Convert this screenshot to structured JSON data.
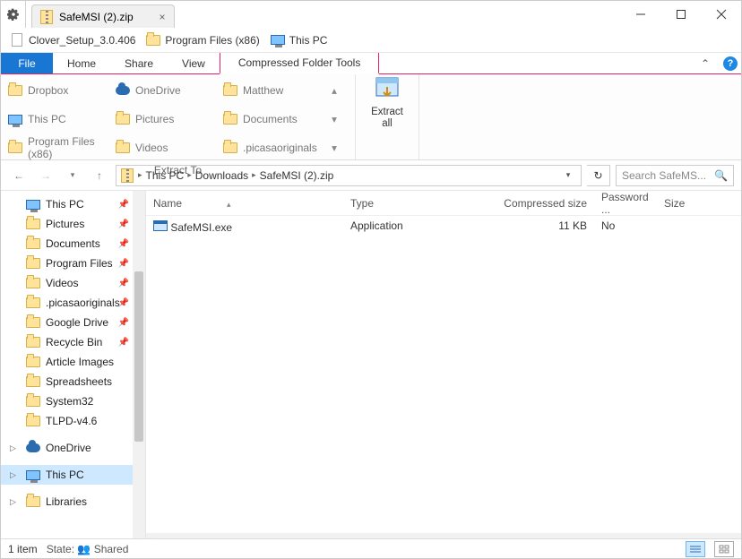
{
  "titlebar": {
    "tab_title": "SafeMSI (2).zip"
  },
  "shelf": [
    {
      "label": "Clover_Setup_3.0.406",
      "icon": "page"
    },
    {
      "label": "Program Files (x86)",
      "icon": "folder"
    },
    {
      "label": "This PC",
      "icon": "monitor"
    }
  ],
  "menu": {
    "file": "File",
    "tabs": [
      "Home",
      "Share",
      "View"
    ],
    "context_tab": "Compressed Folder Tools"
  },
  "ribbon": {
    "destinations": [
      "Dropbox",
      "OneDrive",
      "Matthew",
      "This PC",
      "Pictures",
      "Documents",
      "Program Files (x86)",
      "Videos",
      ".picasaoriginals"
    ],
    "group_label": "Extract To",
    "extract_all": "Extract\nall"
  },
  "nav": {
    "crumbs": [
      "This PC",
      "Downloads",
      "SafeMSI (2).zip"
    ],
    "search_placeholder": "Search SafeMS..."
  },
  "columns": {
    "name": "Name",
    "type": "Type",
    "comp": "Compressed size",
    "pwd": "Password ...",
    "size": "Size"
  },
  "rows": [
    {
      "name": "SafeMSI.exe",
      "type": "Application",
      "comp": "11 KB",
      "pwd": "No",
      "size": ""
    }
  ],
  "tree": [
    {
      "label": "This PC",
      "icon": "monitor",
      "pin": true
    },
    {
      "label": "Pictures",
      "icon": "folder",
      "pin": true
    },
    {
      "label": "Documents",
      "icon": "folder",
      "pin": true
    },
    {
      "label": "Program Files",
      "icon": "folder",
      "pin": true
    },
    {
      "label": "Videos",
      "icon": "folder",
      "pin": true
    },
    {
      "label": ".picasaoriginals",
      "icon": "folder",
      "pin": true
    },
    {
      "label": "Google Drive",
      "icon": "folder",
      "pin": true
    },
    {
      "label": "Recycle Bin",
      "icon": "folder",
      "pin": true
    },
    {
      "label": "Article Images",
      "icon": "folder"
    },
    {
      "label": "Spreadsheets",
      "icon": "folder"
    },
    {
      "label": "System32",
      "icon": "folder"
    },
    {
      "label": "TLPD-v4.6",
      "icon": "folder"
    },
    {
      "label": "OneDrive",
      "icon": "cloud",
      "spaced": true,
      "tri": true
    },
    {
      "label": "This PC",
      "icon": "monitor",
      "selected": true,
      "spaced": true,
      "tri": true
    },
    {
      "label": "Libraries",
      "icon": "folder",
      "spaced": true,
      "tri": true
    }
  ],
  "status": {
    "items": "1 item",
    "state_label": "State:",
    "state_value": "Shared"
  }
}
